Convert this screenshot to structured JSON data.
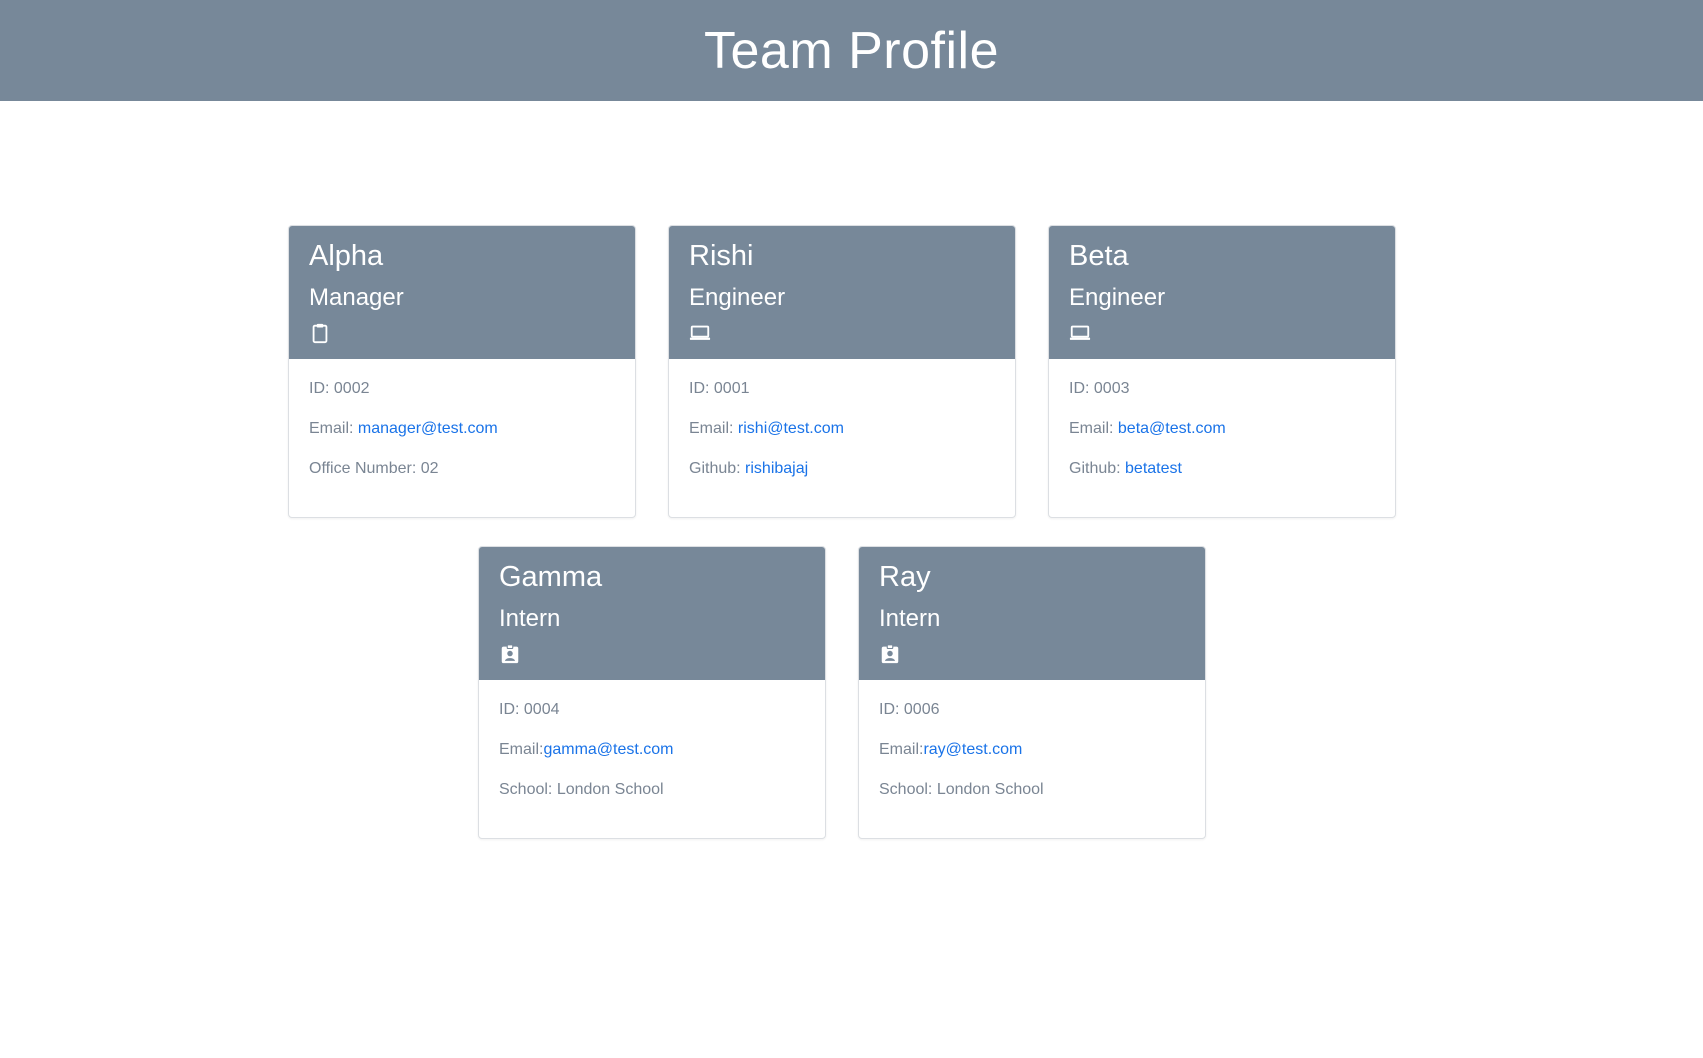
{
  "header": {
    "title": "Team Profile"
  },
  "cards": [
    {
      "name": "Alpha",
      "role": "Manager",
      "icon": "clipboard-icon",
      "id_text": "ID: 0002",
      "email_label": "Email: ",
      "email": "manager@test.com",
      "extra_label": "Office Number: 02",
      "extra_value": ""
    },
    {
      "name": "Rishi",
      "role": "Engineer",
      "icon": "laptop-icon",
      "id_text": "ID: 0001",
      "email_label": "Email: ",
      "email": "rishi@test.com",
      "extra_label": "Github: ",
      "extra_value": "rishibajaj"
    },
    {
      "name": "Beta",
      "role": "Engineer",
      "icon": "laptop-icon",
      "id_text": "ID: 0003",
      "email_label": "Email: ",
      "email": "beta@test.com",
      "extra_label": "Github: ",
      "extra_value": "betatest"
    },
    {
      "name": "Gamma",
      "role": "Intern",
      "icon": "id-badge-icon",
      "id_text": "ID: 0004",
      "email_label": "Email:",
      "email": "gamma@test.com",
      "extra_label": "School: London School",
      "extra_value": ""
    },
    {
      "name": "Ray",
      "role": "Intern",
      "icon": "id-badge-icon",
      "id_text": "ID: 0006",
      "email_label": "Email:",
      "email": "ray@test.com",
      "extra_label": "School: London School",
      "extra_value": ""
    }
  ],
  "colors": {
    "header_bg": "#778899",
    "link": "#1a73e8",
    "muted_text": "#7a8593"
  }
}
